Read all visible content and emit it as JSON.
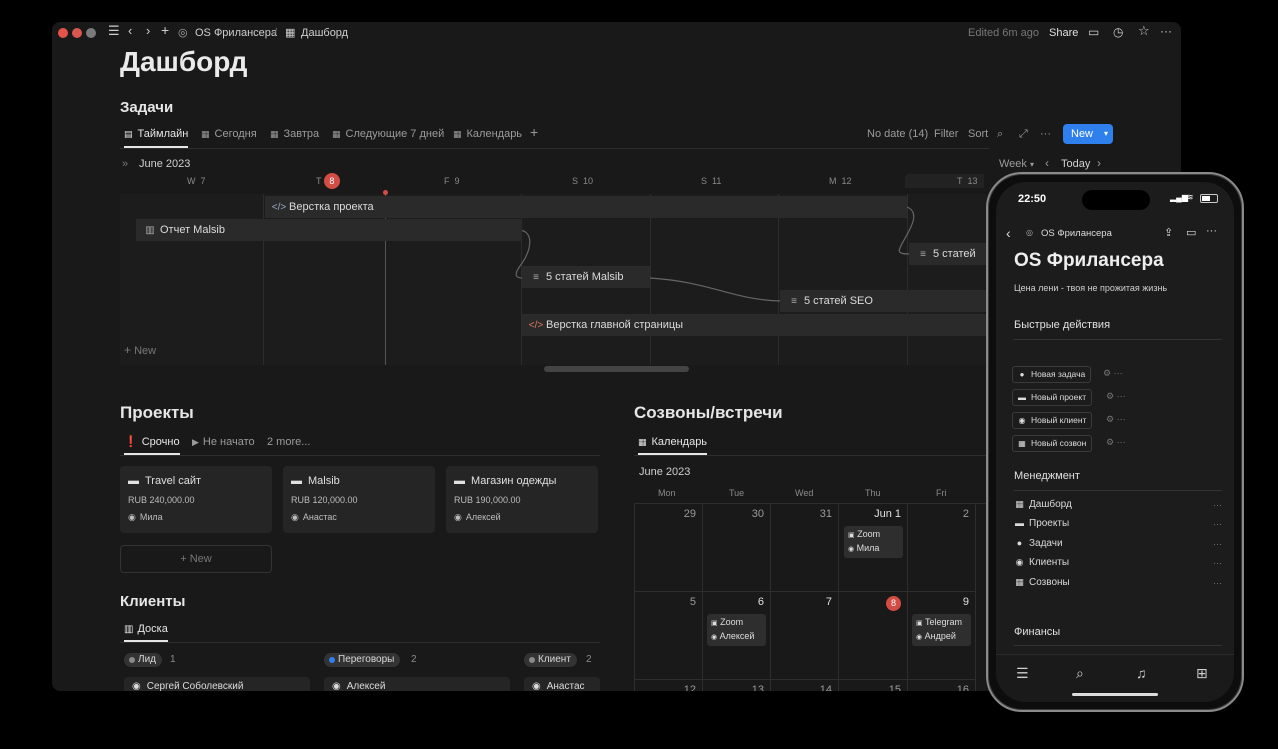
{
  "titlebar": {
    "breadcrumb_workspace": "OS Фрилансера",
    "breadcrumb_sep": "/",
    "breadcrumb_page": "Дашборд",
    "edited": "Edited 6m ago",
    "share": "Share"
  },
  "page": {
    "title": "Дашборд"
  },
  "tasks": {
    "heading": "Задачи",
    "tabs": [
      {
        "label": "Таймлайн",
        "icon": "timeline-icon",
        "active": true
      },
      {
        "label": "Сегодня",
        "icon": "calendar-icon"
      },
      {
        "label": "Завтра",
        "icon": "calendar-icon"
      },
      {
        "label": "Следующие 7 дней",
        "icon": "calendar-icon"
      },
      {
        "label": "Календарь",
        "icon": "calendar-icon"
      }
    ],
    "tools": {
      "nodate": "No date (14)",
      "filter": "Filter",
      "sort": "Sort",
      "new": "New"
    },
    "timeline": {
      "month": "June 2023",
      "scale": "Week",
      "today": "Today",
      "days": [
        {
          "wd": "W",
          "d": "7"
        },
        {
          "wd": "T",
          "d": "8",
          "today": true
        },
        {
          "wd": "F",
          "d": "9"
        },
        {
          "wd": "S",
          "d": "10"
        },
        {
          "wd": "S",
          "d": "11"
        },
        {
          "wd": "M",
          "d": "12"
        },
        {
          "wd": "T",
          "d": "13"
        }
      ],
      "bars": [
        {
          "label": "Верстка проекта",
          "icon": "code-icon"
        },
        {
          "label": "Отчет Malsib",
          "icon": "chart-icon"
        },
        {
          "label": "5 статей",
          "icon": "text-icon"
        },
        {
          "label": "5 статей Malsib",
          "icon": "text-icon"
        },
        {
          "label": "5 статей SEO",
          "icon": "text-icon"
        },
        {
          "label": "Верстка главной страницы",
          "icon": "code-icon"
        }
      ],
      "add_new": "New"
    }
  },
  "projects": {
    "heading": "Проекты",
    "tabs": [
      {
        "label": "Срочно",
        "active": true
      },
      {
        "label": "Не начато"
      },
      {
        "label": "2 more..."
      }
    ],
    "cards": [
      {
        "title": "Travel сайт",
        "price": "RUB 240,000.00",
        "person": "Мила"
      },
      {
        "title": "Malsib",
        "price": "RUB 120,000.00",
        "person": "Анастас"
      },
      {
        "title": "Магазин одежды",
        "price": "RUB 190,000.00",
        "person": "Алексей"
      }
    ],
    "add_new": "New"
  },
  "clients": {
    "heading": "Клиенты",
    "tab": "Доска",
    "groups": [
      {
        "label": "Лид",
        "count": "1",
        "color": "#8a8a8a",
        "card": "Сергей Соболевский"
      },
      {
        "label": "Переговоры",
        "count": "2",
        "color": "#2f80ed",
        "card": "Алексей"
      },
      {
        "label": "Клиент",
        "count": "2",
        "color": "#8a8a8a",
        "card": "Анастас"
      }
    ]
  },
  "meetings": {
    "heading": "Созвоны/встречи",
    "tab": "Календарь",
    "month": "June 2023",
    "weekdays": [
      "Mon",
      "Tue",
      "Wed",
      "Thu",
      "Fri"
    ],
    "week1": [
      "29",
      "30",
      "31",
      "Jun 1",
      "2"
    ],
    "week2": [
      "5",
      "6",
      "7",
      "8",
      "9"
    ],
    "week3": [
      "12",
      "13",
      "14",
      "15",
      "16"
    ],
    "events": [
      {
        "title": "Zoom",
        "person": "Мила"
      },
      {
        "title": "Zoom",
        "person": "Алексей"
      },
      {
        "title": "Telegram",
        "person": "Андрей"
      }
    ]
  },
  "phone": {
    "time": "22:50",
    "back_label": "OS Фрилансера",
    "title": "OS Фрилансера",
    "subtitle": "Цена лени - твоя не прожитая жизнь",
    "quick_heading": "Быстрые действия",
    "quick_actions": [
      {
        "label": "Новая задача",
        "icon": "check-circle-icon"
      },
      {
        "label": "Новый проект",
        "icon": "folder-icon"
      },
      {
        "label": "Новый клиент",
        "icon": "user-icon"
      },
      {
        "label": "Новый созвон",
        "icon": "calendar-icon"
      }
    ],
    "mgmt_heading": "Менеджмент",
    "mgmt_items": [
      {
        "label": "Дашборд",
        "icon": "grid-icon"
      },
      {
        "label": "Проекты",
        "icon": "folder-icon"
      },
      {
        "label": "Задачи",
        "icon": "check-circle-icon"
      },
      {
        "label": "Клиенты",
        "icon": "user-icon"
      },
      {
        "label": "Созвоны",
        "icon": "calendar-icon"
      }
    ],
    "finance_heading": "Финансы"
  }
}
